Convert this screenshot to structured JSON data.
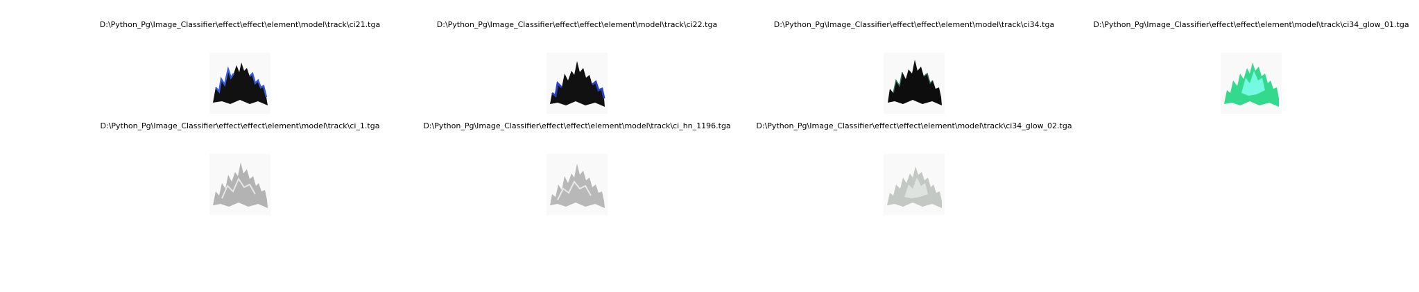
{
  "figure": {
    "images": [
      {
        "title": "D:\\Python_Pg\\Image_Classifier\\effect\\effect\\element\\model\\track\\ci21.tga",
        "main_color": "#111111",
        "accent_color": "#3a5bd9",
        "icon": "dark-flame-blue-edge"
      },
      {
        "title": "D:\\Python_Pg\\Image_Classifier\\effect\\effect\\element\\model\\track\\ci22.tga",
        "main_color": "#111111",
        "accent_color": "#2741c8",
        "icon": "dark-flame-blue-edge"
      },
      {
        "title": "D:\\Python_Pg\\Image_Classifier\\effect\\effect\\element\\model\\track\\ci34.tga",
        "main_color": "#0d0d0d",
        "accent_color": "#2c6b4f",
        "icon": "dark-flame-green-tint"
      },
      {
        "title": "D:\\Python_Pg\\Image_Classifier\\effect\\effect\\element\\model\\track\\ci34_glow_01.tga",
        "main_color": "#33d98c",
        "accent_color": "#7ffff0",
        "icon": "green-glow-flame"
      },
      {
        "title": "D:\\Python_Pg\\Image_Classifier\\effect\\effect\\element\\model\\track\\ci_1.tga",
        "main_color": "#b3b3b3",
        "accent_color": "#e6e6e6",
        "icon": "light-gray-flame"
      },
      {
        "title": "D:\\Python_Pg\\Image_Classifier\\effect\\effect\\element\\model\\track\\ci_hn_1196.tga",
        "main_color": "#b8b8b8",
        "accent_color": "#e9e9e9",
        "icon": "light-gray-flame"
      },
      {
        "title": "D:\\Python_Pg\\Image_Classifier\\effect\\effect\\element\\model\\track\\ci34_glow_02.tga",
        "main_color": "#c3c8c4",
        "accent_color": "#e4e8e5",
        "icon": "pale-gray-flame"
      }
    ]
  }
}
